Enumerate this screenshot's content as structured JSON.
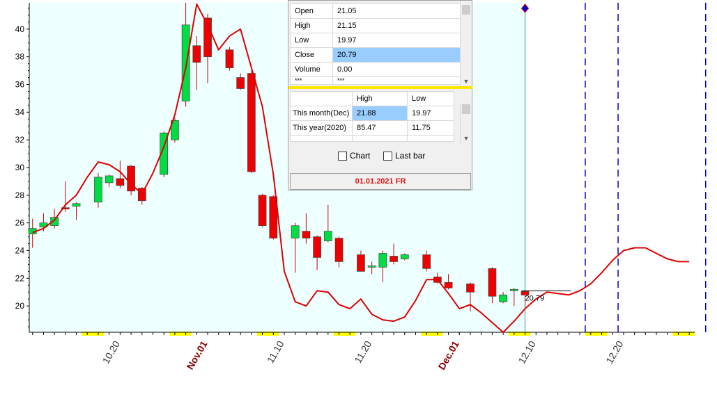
{
  "chart_data": {
    "type": "candlestick",
    "y_ticks": [
      20,
      22,
      24,
      26,
      28,
      30,
      32,
      34,
      36,
      38,
      40
    ],
    "ylim": [
      18.1,
      41.9
    ],
    "x_labels": [
      {
        "text": "10.20",
        "month_start": false,
        "day": 8
      },
      {
        "text": "Nov.01",
        "month_start": true,
        "day": 16
      },
      {
        "text": "11.10",
        "month_start": false,
        "day": 23
      },
      {
        "text": "11.20",
        "month_start": false,
        "day": 31
      },
      {
        "text": "Dec.01",
        "month_start": true,
        "day": 39
      },
      {
        "text": "12.10",
        "month_start": false,
        "day": 46
      },
      {
        "text": "12.20",
        "month_start": false,
        "day": 54
      }
    ],
    "xlim": [
      -0.3,
      60.5
    ],
    "weekend_marks": [
      {
        "from": 4.5,
        "to": 6.5
      },
      {
        "from": 12.5,
        "to": 14.5
      },
      {
        "from": 20.5,
        "to": 22.5
      },
      {
        "from": 27.5,
        "to": 29.5
      },
      {
        "from": 35.5,
        "to": 37.5
      },
      {
        "from": 43.5,
        "to": 45.5
      },
      {
        "from": 50.5,
        "to": 52.5
      },
      {
        "from": 58.5,
        "to": 60.5
      }
    ],
    "candles": [
      {
        "d": 0,
        "o": 25.2,
        "h": 26.3,
        "l": 24.2,
        "c": 25.6
      },
      {
        "d": 1,
        "o": 25.7,
        "h": 26.7,
        "l": 25.4,
        "c": 26.0
      },
      {
        "d": 2,
        "o": 25.8,
        "h": 27.0,
        "l": 25.6,
        "c": 26.4
      },
      {
        "d": 3,
        "o": 27.1,
        "h": 29.0,
        "l": 26.8,
        "c": 27.0
      },
      {
        "d": 4,
        "o": 27.2,
        "h": 27.5,
        "l": 26.2,
        "c": 27.4
      },
      {
        "d": 6,
        "o": 27.5,
        "h": 29.6,
        "l": 27.1,
        "c": 29.3
      },
      {
        "d": 7,
        "o": 28.9,
        "h": 29.5,
        "l": 28.6,
        "c": 29.4
      },
      {
        "d": 8,
        "o": 29.2,
        "h": 30.5,
        "l": 28.5,
        "c": 28.7
      },
      {
        "d": 9,
        "o": 30.1,
        "h": 30.2,
        "l": 28.0,
        "c": 28.3
      },
      {
        "d": 10,
        "o": 28.5,
        "h": 28.6,
        "l": 27.3,
        "c": 27.6
      },
      {
        "d": 12,
        "o": 29.5,
        "h": 32.6,
        "l": 29.3,
        "c": 32.5
      },
      {
        "d": 13,
        "o": 32.0,
        "h": 33.6,
        "l": 31.8,
        "c": 33.4
      },
      {
        "d": 14,
        "o": 34.8,
        "h": 41.9,
        "l": 34.4,
        "c": 40.3
      },
      {
        "d": 15,
        "o": 38.8,
        "h": 39.5,
        "l": 35.6,
        "c": 37.6
      },
      {
        "d": 16,
        "o": 40.8,
        "h": 41.1,
        "l": 36.1,
        "c": 38.0
      },
      {
        "d": 18,
        "o": 38.5,
        "h": 38.7,
        "l": 37.0,
        "c": 37.2
      },
      {
        "d": 19,
        "o": 36.5,
        "h": 36.8,
        "l": 35.6,
        "c": 35.7
      },
      {
        "d": 20,
        "o": 36.8,
        "h": 37.0,
        "l": 29.6,
        "c": 29.7
      },
      {
        "d": 21,
        "o": 28.0,
        "h": 28.1,
        "l": 25.7,
        "c": 25.8
      },
      {
        "d": 22,
        "o": 27.9,
        "h": 28.0,
        "l": 24.8,
        "c": 24.9
      },
      {
        "d": 24,
        "o": 24.9,
        "h": 26.0,
        "l": 22.4,
        "c": 25.8
      },
      {
        "d": 25,
        "o": 25.4,
        "h": 26.7,
        "l": 24.5,
        "c": 24.9
      },
      {
        "d": 26,
        "o": 25.0,
        "h": 25.1,
        "l": 22.6,
        "c": 23.5
      },
      {
        "d": 27,
        "o": 24.7,
        "h": 27.3,
        "l": 24.6,
        "c": 25.4
      },
      {
        "d": 28,
        "o": 24.9,
        "h": 25.0,
        "l": 22.8,
        "c": 23.2
      },
      {
        "d": 30,
        "o": 23.7,
        "h": 24.0,
        "l": 22.5,
        "c": 22.5
      },
      {
        "d": 31,
        "o": 22.8,
        "h": 23.2,
        "l": 22.3,
        "c": 22.9
      },
      {
        "d": 32,
        "o": 22.8,
        "h": 24.0,
        "l": 21.7,
        "c": 23.8
      },
      {
        "d": 33,
        "o": 23.6,
        "h": 24.5,
        "l": 23.0,
        "c": 23.2
      },
      {
        "d": 34,
        "o": 23.4,
        "h": 23.8,
        "l": 23.3,
        "c": 23.7
      },
      {
        "d": 36,
        "o": 23.7,
        "h": 24.0,
        "l": 22.5,
        "c": 22.7
      },
      {
        "d": 37,
        "o": 22.1,
        "h": 22.4,
        "l": 21.6,
        "c": 21.7
      },
      {
        "d": 38,
        "o": 21.7,
        "h": 22.3,
        "l": 21.2,
        "c": 21.3
      },
      {
        "d": 40,
        "o": 21.6,
        "h": 21.7,
        "l": 19.6,
        "c": 21.0
      },
      {
        "d": 42,
        "o": 22.7,
        "h": 22.8,
        "l": 20.2,
        "c": 20.7
      },
      {
        "d": 43,
        "o": 20.3,
        "h": 21.0,
        "l": 20.2,
        "c": 20.8
      },
      {
        "d": 44,
        "o": 21.1,
        "h": 21.3,
        "l": 20.0,
        "c": 21.2
      },
      {
        "d": 45,
        "o": 21.05,
        "h": 21.15,
        "l": 19.97,
        "c": 20.79
      }
    ],
    "forecast_line": [
      {
        "d": 0,
        "v": 25.3
      },
      {
        "d": 1,
        "v": 25.6
      },
      {
        "d": 2,
        "v": 26.2
      },
      {
        "d": 3,
        "v": 27.3
      },
      {
        "d": 4,
        "v": 28.0
      },
      {
        "d": 5,
        "v": 29.3
      },
      {
        "d": 6,
        "v": 30.4
      },
      {
        "d": 7,
        "v": 30.2
      },
      {
        "d": 8,
        "v": 29.7
      },
      {
        "d": 9,
        "v": 28.8
      },
      {
        "d": 10,
        "v": 28.1
      },
      {
        "d": 11,
        "v": 29.6
      },
      {
        "d": 12,
        "v": 31.5
      },
      {
        "d": 13,
        "v": 33.8
      },
      {
        "d": 14,
        "v": 37.2
      },
      {
        "d": 15,
        "v": 41.8
      },
      {
        "d": 16,
        "v": 40.3
      },
      {
        "d": 17,
        "v": 38.5
      },
      {
        "d": 18,
        "v": 39.5
      },
      {
        "d": 19,
        "v": 40.0
      },
      {
        "d": 20,
        "v": 37.2
      },
      {
        "d": 21,
        "v": 34.4
      },
      {
        "d": 22,
        "v": 29.5
      },
      {
        "d": 23,
        "v": 22.5
      },
      {
        "d": 24,
        "v": 20.3
      },
      {
        "d": 25,
        "v": 20.0
      },
      {
        "d": 26,
        "v": 21.1
      },
      {
        "d": 27,
        "v": 21.0
      },
      {
        "d": 28,
        "v": 20.1
      },
      {
        "d": 29,
        "v": 19.8
      },
      {
        "d": 30,
        "v": 20.5
      },
      {
        "d": 31,
        "v": 19.4
      },
      {
        "d": 32,
        "v": 19.0
      },
      {
        "d": 33,
        "v": 18.9
      },
      {
        "d": 34,
        "v": 19.2
      },
      {
        "d": 35,
        "v": 20.4
      },
      {
        "d": 36,
        "v": 21.9
      },
      {
        "d": 37,
        "v": 21.9
      },
      {
        "d": 38,
        "v": 20.9
      },
      {
        "d": 39,
        "v": 19.8
      },
      {
        "d": 40,
        "v": 20.1
      },
      {
        "d": 41,
        "v": 19.5
      },
      {
        "d": 42,
        "v": 18.8
      },
      {
        "d": 43,
        "v": 18.1
      },
      {
        "d": 44,
        "v": 18.9
      },
      {
        "d": 45,
        "v": 19.8
      },
      {
        "d": 46,
        "v": 20.5
      },
      {
        "d": 47,
        "v": 21.0
      },
      {
        "d": 48,
        "v": 20.9
      },
      {
        "d": 49,
        "v": 20.8
      },
      {
        "d": 50,
        "v": 21.1
      },
      {
        "d": 51,
        "v": 21.6
      },
      {
        "d": 52,
        "v": 22.4
      },
      {
        "d": 53,
        "v": 23.3
      },
      {
        "d": 54,
        "v": 24.0
      },
      {
        "d": 55,
        "v": 24.2
      },
      {
        "d": 56,
        "v": 24.2
      },
      {
        "d": 57,
        "v": 23.8
      },
      {
        "d": 58,
        "v": 23.4
      },
      {
        "d": 59,
        "v": 23.2
      },
      {
        "d": 60,
        "v": 23.2
      },
      {
        "d": 61,
        "v": 23.7
      },
      {
        "d": 62,
        "v": 24.5
      },
      {
        "d": 63,
        "v": 25.8
      },
      {
        "d": 64,
        "v": 27.4
      },
      {
        "d": 65,
        "v": 29.0
      },
      {
        "d": 66,
        "v": 30.7
      },
      {
        "d": 67,
        "v": 32.3
      },
      {
        "d": 68,
        "v": 33.5
      },
      {
        "d": 69,
        "v": 34.1
      },
      {
        "d": 70,
        "v": 34.0
      },
      {
        "d": 71,
        "v": 33.4
      },
      {
        "d": 72,
        "v": 32.8
      }
    ],
    "current_price": "20.79",
    "current_day": 45,
    "dashed_markers": [
      50.5,
      53.5,
      61.5
    ],
    "colors": {
      "up": "#00dd44",
      "down": "#ee0000",
      "line": "#dd0000",
      "plot_bg": "#eeffff",
      "marker": "#0000cc",
      "month_label": "#880000",
      "weekend": "#ffff00"
    }
  },
  "info_table": {
    "rows": [
      {
        "label": "Open",
        "value": "21.05"
      },
      {
        "label": "High",
        "value": "21.15"
      },
      {
        "label": "Low",
        "value": "19.97"
      },
      {
        "label": "Close",
        "value": "20.79"
      },
      {
        "label": "Volume",
        "value": "0.00"
      },
      {
        "label": "***",
        "value": "***"
      }
    ]
  },
  "period_table": {
    "col_high": "High",
    "col_low": "Low",
    "rows": [
      {
        "label": "This month(Dec)",
        "high": "21.88",
        "low": "19.97"
      },
      {
        "label": "This year(2020)",
        "high": "85.47",
        "low": "11.75"
      }
    ]
  },
  "options": {
    "chart_label": "Chart",
    "last_bar_label": "Last bar"
  },
  "date_text": "01.01.2021 FR"
}
